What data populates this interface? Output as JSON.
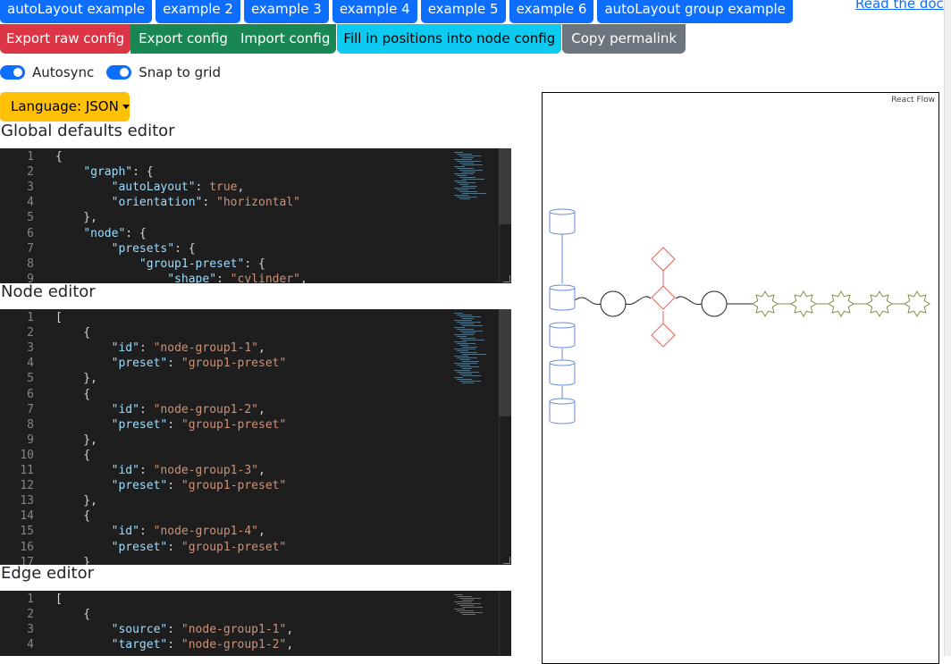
{
  "nav": {
    "tabs": [
      "autoLayout example",
      "example 2",
      "example 3",
      "example 4",
      "example 5",
      "example 6",
      "autoLayout group example"
    ],
    "docs_link": "Read the docs"
  },
  "actions": {
    "export_raw": "Export raw config",
    "export": "Export config",
    "import": "Import config",
    "fill_positions": "Fill in positions into node config",
    "copy_permalink": "Copy permalink"
  },
  "toggles": {
    "autosync_label": "Autosync",
    "autosync_on": true,
    "snap_label": "Snap to grid",
    "snap_on": true
  },
  "language": {
    "label": "Language: JSON"
  },
  "editors": {
    "global": {
      "title": "Global defaults editor",
      "lines": [
        {
          "n": "1",
          "tokens": [
            [
              "p",
              "{"
            ]
          ]
        },
        {
          "n": "2",
          "tokens": [
            [
              "p",
              "    "
            ],
            [
              "k",
              "\"graph\""
            ],
            [
              "p",
              ": {"
            ]
          ]
        },
        {
          "n": "3",
          "tokens": [
            [
              "p",
              "        "
            ],
            [
              "k",
              "\"autoLayout\""
            ],
            [
              "p",
              ": "
            ],
            [
              "s",
              "true"
            ],
            [
              "p",
              ","
            ]
          ]
        },
        {
          "n": "4",
          "tokens": [
            [
              "p",
              "        "
            ],
            [
              "k",
              "\"orientation\""
            ],
            [
              "p",
              ": "
            ],
            [
              "s",
              "\"horizontal\""
            ]
          ]
        },
        {
          "n": "5",
          "tokens": [
            [
              "p",
              "    },"
            ]
          ]
        },
        {
          "n": "6",
          "tokens": [
            [
              "p",
              "    "
            ],
            [
              "k",
              "\"node\""
            ],
            [
              "p",
              ": {"
            ]
          ]
        },
        {
          "n": "7",
          "tokens": [
            [
              "p",
              "        "
            ],
            [
              "k",
              "\"presets\""
            ],
            [
              "p",
              ": {"
            ]
          ]
        },
        {
          "n": "8",
          "tokens": [
            [
              "p",
              "            "
            ],
            [
              "k",
              "\"group1-preset\""
            ],
            [
              "p",
              ": {"
            ]
          ]
        },
        {
          "n": "9",
          "tokens": [
            [
              "p",
              "                "
            ],
            [
              "k",
              "\"shape\""
            ],
            [
              "p",
              ": "
            ],
            [
              "s",
              "\"cylinder\""
            ],
            [
              "p",
              ","
            ]
          ]
        }
      ]
    },
    "node": {
      "title": "Node editor",
      "lines": [
        {
          "n": "1",
          "tokens": [
            [
              "p",
              "["
            ]
          ]
        },
        {
          "n": "2",
          "tokens": [
            [
              "p",
              "    {"
            ]
          ]
        },
        {
          "n": "3",
          "tokens": [
            [
              "p",
              "        "
            ],
            [
              "k",
              "\"id\""
            ],
            [
              "p",
              ": "
            ],
            [
              "s",
              "\"node-group1-1\""
            ],
            [
              "p",
              ","
            ]
          ]
        },
        {
          "n": "4",
          "tokens": [
            [
              "p",
              "        "
            ],
            [
              "k",
              "\"preset\""
            ],
            [
              "p",
              ": "
            ],
            [
              "s",
              "\"group1-preset\""
            ]
          ]
        },
        {
          "n": "5",
          "tokens": [
            [
              "p",
              "    },"
            ]
          ]
        },
        {
          "n": "6",
          "tokens": [
            [
              "p",
              "    {"
            ]
          ]
        },
        {
          "n": "7",
          "tokens": [
            [
              "p",
              "        "
            ],
            [
              "k",
              "\"id\""
            ],
            [
              "p",
              ": "
            ],
            [
              "s",
              "\"node-group1-2\""
            ],
            [
              "p",
              ","
            ]
          ]
        },
        {
          "n": "8",
          "tokens": [
            [
              "p",
              "        "
            ],
            [
              "k",
              "\"preset\""
            ],
            [
              "p",
              ": "
            ],
            [
              "s",
              "\"group1-preset\""
            ]
          ]
        },
        {
          "n": "9",
          "tokens": [
            [
              "p",
              "    },"
            ]
          ]
        },
        {
          "n": "10",
          "tokens": [
            [
              "p",
              "    {"
            ]
          ]
        },
        {
          "n": "11",
          "tokens": [
            [
              "p",
              "        "
            ],
            [
              "k",
              "\"id\""
            ],
            [
              "p",
              ": "
            ],
            [
              "s",
              "\"node-group1-3\""
            ],
            [
              "p",
              ","
            ]
          ]
        },
        {
          "n": "12",
          "tokens": [
            [
              "p",
              "        "
            ],
            [
              "k",
              "\"preset\""
            ],
            [
              "p",
              ": "
            ],
            [
              "s",
              "\"group1-preset\""
            ]
          ]
        },
        {
          "n": "13",
          "tokens": [
            [
              "p",
              "    },"
            ]
          ]
        },
        {
          "n": "14",
          "tokens": [
            [
              "p",
              "    {"
            ]
          ]
        },
        {
          "n": "15",
          "tokens": [
            [
              "p",
              "        "
            ],
            [
              "k",
              "\"id\""
            ],
            [
              "p",
              ": "
            ],
            [
              "s",
              "\"node-group1-4\""
            ],
            [
              "p",
              ","
            ]
          ]
        },
        {
          "n": "16",
          "tokens": [
            [
              "p",
              "        "
            ],
            [
              "k",
              "\"preset\""
            ],
            [
              "p",
              ": "
            ],
            [
              "s",
              "\"group1-preset\""
            ]
          ]
        },
        {
          "n": "17",
          "tokens": [
            [
              "p",
              "    }"
            ]
          ]
        }
      ]
    },
    "edge": {
      "title": "Edge editor",
      "lines": [
        {
          "n": "1",
          "tokens": [
            [
              "p",
              "["
            ]
          ]
        },
        {
          "n": "2",
          "tokens": [
            [
              "p",
              "    {"
            ]
          ]
        },
        {
          "n": "3",
          "tokens": [
            [
              "p",
              "        "
            ],
            [
              "k",
              "\"source\""
            ],
            [
              "p",
              ": "
            ],
            [
              "s",
              "\"node-group1-1\""
            ],
            [
              "p",
              ","
            ]
          ]
        },
        {
          "n": "4",
          "tokens": [
            [
              "p",
              "        "
            ],
            [
              "k",
              "\"target\""
            ],
            [
              "p",
              ": "
            ],
            [
              "s",
              "\"node-group1-2\""
            ],
            [
              "p",
              ","
            ]
          ]
        }
      ]
    }
  },
  "flow": {
    "attribution": "React Flow",
    "colors": {
      "cylinder": "#6b8bd6",
      "diamond": "#e0655a",
      "circle": "#222222",
      "star": "#8b8b4a"
    }
  }
}
